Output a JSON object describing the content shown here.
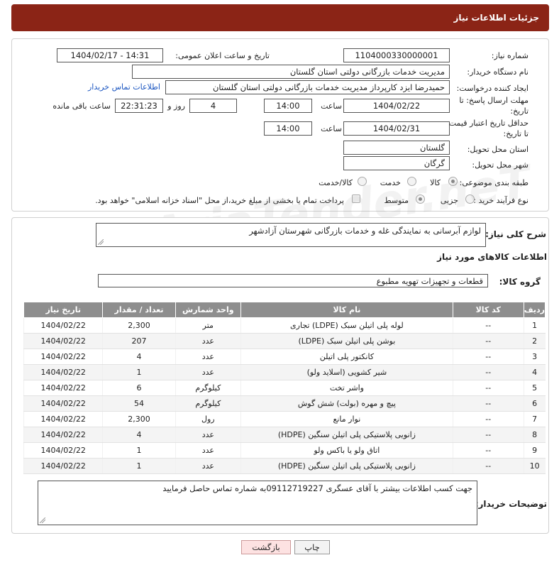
{
  "header": {
    "title": "جزئیات اطلاعات نیاز"
  },
  "fields": {
    "need_number_label": "شماره نیاز:",
    "need_number": "1104000330000001",
    "announce_label": "تاریخ و ساعت اعلان عمومی:",
    "announce_value": "1404/02/17 - 14:31",
    "buyer_org_label": "نام دستگاه خریدار:",
    "buyer_org": "مدیریت خدمات بازرگانی دولتی استان گلستان",
    "creator_label": "ایجاد کننده درخواست:",
    "creator": "حمیدرضا ایزد کارپرداز مدیریت خدمات بازرگانی دولتی استان گلستان",
    "buyer_contact_link": "اطلاعات تماس خریدار",
    "reply_deadline_label": "مهلت ارسال پاسخ: تا تاریخ:",
    "reply_date": "1404/02/22",
    "reply_time_label": "ساعت",
    "reply_time": "14:00",
    "days": "4",
    "days_label": "روز و",
    "remaining_time": "22:31:23",
    "remaining_label": "ساعت باقی مانده",
    "price_deadline_label": "حداقل تاریخ اعتبار قیمت: تا تاریخ:",
    "price_date": "1404/02/31",
    "price_time_label": "ساعت",
    "price_time": "14:00",
    "province_label": "استان محل تحویل:",
    "province": "گلستان",
    "city_label": "شهر محل تحویل:",
    "city": "گرگان",
    "category_label": "طبقه بندی موضوعی:",
    "category_options": [
      "کالا",
      "خدمت",
      "کالا/خدمت"
    ],
    "process_label": "نوع فرآیند خرید :",
    "process_options": [
      "جزیی",
      "متوسط"
    ],
    "payment_note": "پرداخت تمام یا بخشی از مبلغ خرید،از محل \"اسناد خزانه اسلامی\" خواهد بود."
  },
  "description": {
    "label": "شرح کلی نیاز:",
    "value": "لوازم آبرسانی به نمایندگی غله و خدمات بازرگانی شهرستان آزادشهر"
  },
  "goods": {
    "section_title": "اطلاعات کالاهای مورد نیاز",
    "group_label": "گروه کالا:",
    "group_value": "قطعات و تجهیزات تهویه مطبوع",
    "columns": [
      "ردیف",
      "کد کالا",
      "نام کالا",
      "واحد شمارش",
      "تعداد / مقدار",
      "تاریخ نیاز"
    ],
    "rows": [
      [
        "1",
        "--",
        "لوله پلی اتیلن سبک (LDPE) تجاری",
        "متر",
        "2,300",
        "1404/02/22"
      ],
      [
        "2",
        "--",
        "بوشن پلی اتیلن سبک (LDPE)",
        "عدد",
        "207",
        "1404/02/22"
      ],
      [
        "3",
        "--",
        "کانکتور پلی اتیلن",
        "عدد",
        "4",
        "1404/02/22"
      ],
      [
        "4",
        "--",
        "شیر کشویی (اسلاید ولو)",
        "عدد",
        "1",
        "1404/02/22"
      ],
      [
        "5",
        "--",
        "واشر تخت",
        "کیلوگرم",
        "6",
        "1404/02/22"
      ],
      [
        "6",
        "--",
        "پیچ و مهره (بولت) شش گوش",
        "کیلوگرم",
        "54",
        "1404/02/22"
      ],
      [
        "7",
        "--",
        "نوار مانع",
        "رول",
        "2,300",
        "1404/02/22"
      ],
      [
        "8",
        "--",
        "زانویی پلاستیکی پلی اتیلن سنگین (HDPE)",
        "عدد",
        "4",
        "1404/02/22"
      ],
      [
        "9",
        "--",
        "اتاق ولو یا باکس ولو",
        "عدد",
        "1",
        "1404/02/22"
      ],
      [
        "10",
        "--",
        "زانویی پلاستیکی پلی اتیلن سنگین (HDPE)",
        "عدد",
        "1",
        "1404/02/22"
      ]
    ]
  },
  "buyer_notes": {
    "label": "توضیحات خریدار:",
    "value": "جهت کسب اطلاعات بیشتر با آقای عسگری 09112719227به شماره تماس حاصل فرمایید"
  },
  "buttons": {
    "print": "چاپ",
    "back": "بازگشت"
  },
  "watermark": {
    "text": "AriaTender.neT"
  }
}
